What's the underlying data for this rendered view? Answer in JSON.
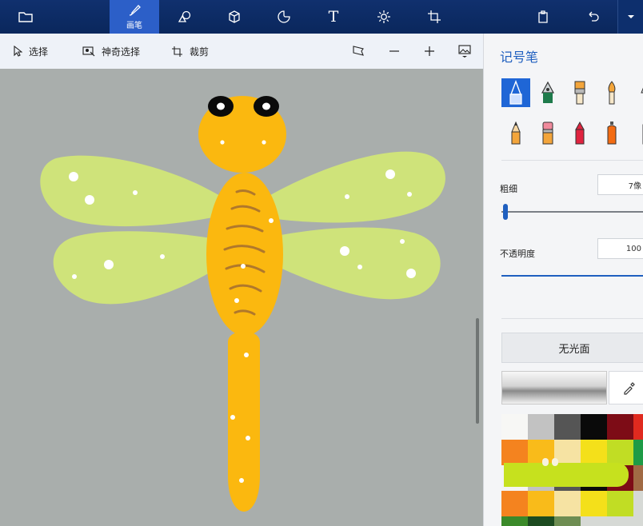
{
  "topbar": {
    "tools": [
      {
        "name": "open-menu",
        "icon": "folder-icon"
      },
      {
        "name": "brushes",
        "icon": "brush-icon",
        "label": "画笔"
      },
      {
        "name": "2d-shapes",
        "icon": "shapes-icon"
      },
      {
        "name": "3d-shapes",
        "icon": "cube-icon"
      },
      {
        "name": "stickers",
        "icon": "sticker-icon"
      },
      {
        "name": "text",
        "icon": "text-icon",
        "glyph": "T"
      },
      {
        "name": "effects",
        "icon": "sun-icon"
      },
      {
        "name": "canvas",
        "icon": "crop-icon"
      },
      {
        "name": "paste",
        "icon": "paste-icon"
      },
      {
        "name": "undo",
        "icon": "undo-icon"
      },
      {
        "name": "more",
        "icon": "chevron-down-icon"
      }
    ],
    "active_label": "画笔"
  },
  "secondary_toolbar": {
    "select_label": "选择",
    "magic_select_label": "神奇选择",
    "crop_label": "裁剪"
  },
  "panel": {
    "title": "记号笔",
    "thickness_label": "粗细",
    "thickness_value": "7像",
    "thickness_fraction": 0.1,
    "opacity_label": "不透明度",
    "opacity_value": "100",
    "opacity_fraction": 1.0,
    "finish_button": "无光面",
    "brushes": [
      "marker-icon",
      "calligraphy-pen-icon",
      "oil-brush-icon",
      "watercolor-icon",
      "pixel-pen-icon",
      "pencil-icon",
      "eraser-icon",
      "crayon-icon",
      "spray-can-icon",
      "fill-icon"
    ],
    "palette_colors": [
      [
        "#f7f7f5",
        "#c2c2c2",
        "#555555",
        "#0a0a0a",
        "#7d0c16",
        "#e02a1f"
      ],
      [
        "#f4831f",
        "#f9bb1a",
        "#f6e3a3",
        "#f4e01a",
        "#c1dd24",
        "#1e9b46"
      ],
      [
        "#f4f4f2",
        "#c2c2c2",
        "#555555",
        "#0a0a0a",
        "#7d0c16",
        "#a16a44"
      ],
      [
        "#f4831f",
        "#f9bb1a",
        "#f6e3a3",
        "#f4e01a",
        "#c1dd24",
        "#d6d9d5"
      ],
      [
        "#3b8a2a",
        "#1d4b20",
        "#6e8d52",
        "#d6d9d5",
        "#d6d9d5",
        "#d6d9d5"
      ]
    ]
  },
  "colors": {
    "topbar": "#0c2b63",
    "accent": "#1f66d6",
    "canvas_bg": "#a9aeac",
    "dragonfly_body": "#fbb80f",
    "wing": "#cfe37a",
    "stripe": "#b0782b"
  }
}
